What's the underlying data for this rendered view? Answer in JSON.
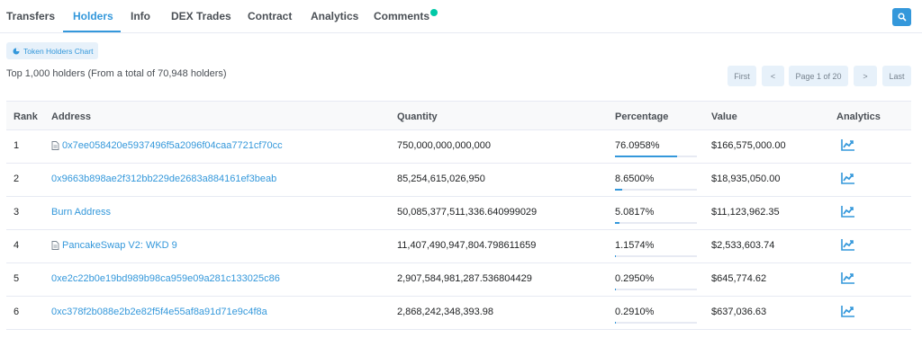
{
  "tabs": [
    {
      "label": "Transfers"
    },
    {
      "label": "Holders"
    },
    {
      "label": "Info"
    },
    {
      "label": "DEX Trades"
    },
    {
      "label": "Contract"
    },
    {
      "label": "Analytics"
    },
    {
      "label": "Comments"
    }
  ],
  "chart_button": "Token Holders Chart",
  "summary": "Top 1,000 holders (From a total of 70,948 holders)",
  "pager": {
    "first": "First",
    "prev": "<",
    "page": "Page 1 of 20",
    "next": ">",
    "last": "Last"
  },
  "columns": {
    "rank": "Rank",
    "address": "Address",
    "quantity": "Quantity",
    "percentage": "Percentage",
    "value": "Value",
    "analytics": "Analytics"
  },
  "rows": [
    {
      "rank": "1",
      "address": "0x7ee058420e5937496f5a2096f04caa7721cf70cc",
      "contract": true,
      "quantity": "750,000,000,000,000",
      "percentage": "76.0958%",
      "pct": 76.0958,
      "value": "$166,575,000.00"
    },
    {
      "rank": "2",
      "address": "0x9663b898ae2f312bb229de2683a884161ef3beab",
      "contract": false,
      "quantity": "85,254,615,026,950",
      "percentage": "8.6500%",
      "pct": 8.65,
      "value": "$18,935,050.00"
    },
    {
      "rank": "3",
      "address": "Burn Address",
      "contract": false,
      "quantity": "50,085,377,511,336.640999029",
      "percentage": "5.0817%",
      "pct": 5.0817,
      "value": "$11,123,962.35"
    },
    {
      "rank": "4",
      "address": "PancakeSwap V2: WKD 9",
      "contract": true,
      "quantity": "11,407,490,947,804.798611659",
      "percentage": "1.1574%",
      "pct": 1.1574,
      "value": "$2,533,603.74"
    },
    {
      "rank": "5",
      "address": "0xe2c22b0e19bd989b98ca959e09a281c133025c86",
      "contract": false,
      "quantity": "2,907,584,981,287.536804429",
      "percentage": "0.2950%",
      "pct": 0.295,
      "value": "$645,774.62"
    },
    {
      "rank": "6",
      "address": "0xc378f2b088e2b2e82f5f4e55af8a91d71e9c4f8a",
      "contract": false,
      "quantity": "2,868,242,348,393.98",
      "percentage": "0.2910%",
      "pct": 0.291,
      "value": "$637,036.63"
    }
  ],
  "colors": {
    "accent": "#3498db",
    "notification": "#00c9a7"
  }
}
